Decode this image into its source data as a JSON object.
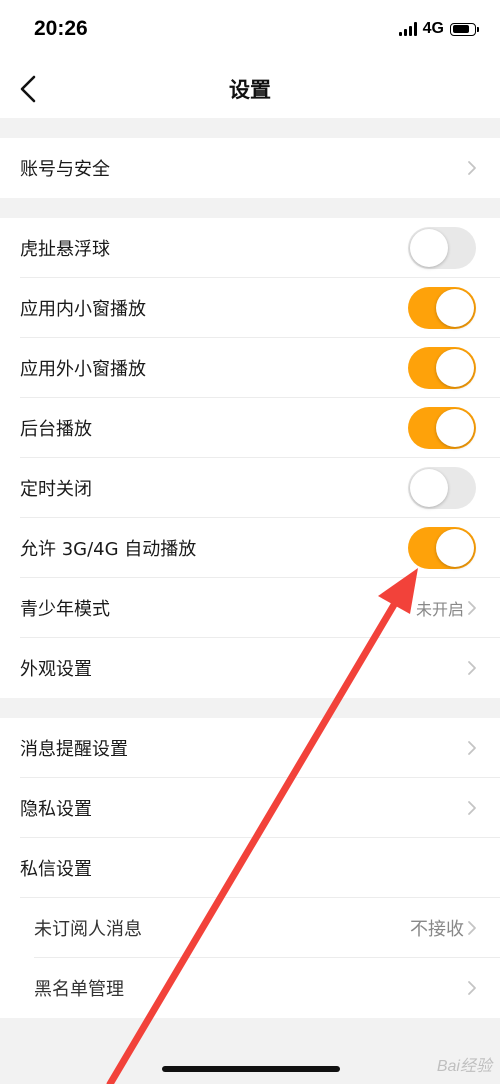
{
  "status_bar": {
    "time": "20:26",
    "network": "4G",
    "battery_level": 0.7
  },
  "nav": {
    "title": "设置",
    "back_icon": "chevron-left-icon"
  },
  "group_account": {
    "items": [
      {
        "label": "账号与安全"
      }
    ]
  },
  "group_playback": {
    "items": [
      {
        "label": "虎扯悬浮球",
        "toggle": false
      },
      {
        "label": "应用内小窗播放",
        "toggle": true
      },
      {
        "label": "应用外小窗播放",
        "toggle": true
      },
      {
        "label": "后台播放",
        "toggle": true
      },
      {
        "label": "定时关闭",
        "toggle": false
      },
      {
        "label": "允许 3G/4G 自动播放",
        "toggle": true
      },
      {
        "label": "青少年模式",
        "value": "未开启"
      },
      {
        "label": "外观设置"
      }
    ]
  },
  "group_privacy": {
    "items": [
      {
        "label": "消息提醒设置"
      },
      {
        "label": "隐私设置"
      },
      {
        "label": "私信设置"
      },
      {
        "label": "未订阅人消息",
        "value": "不接收"
      },
      {
        "label": "黑名单管理"
      }
    ]
  },
  "colors": {
    "accent_toggle_on": "#fea20a",
    "toggle_off": "#e8e8e8",
    "annotation_arrow": "#f2423a"
  },
  "watermark": "Bai经验"
}
